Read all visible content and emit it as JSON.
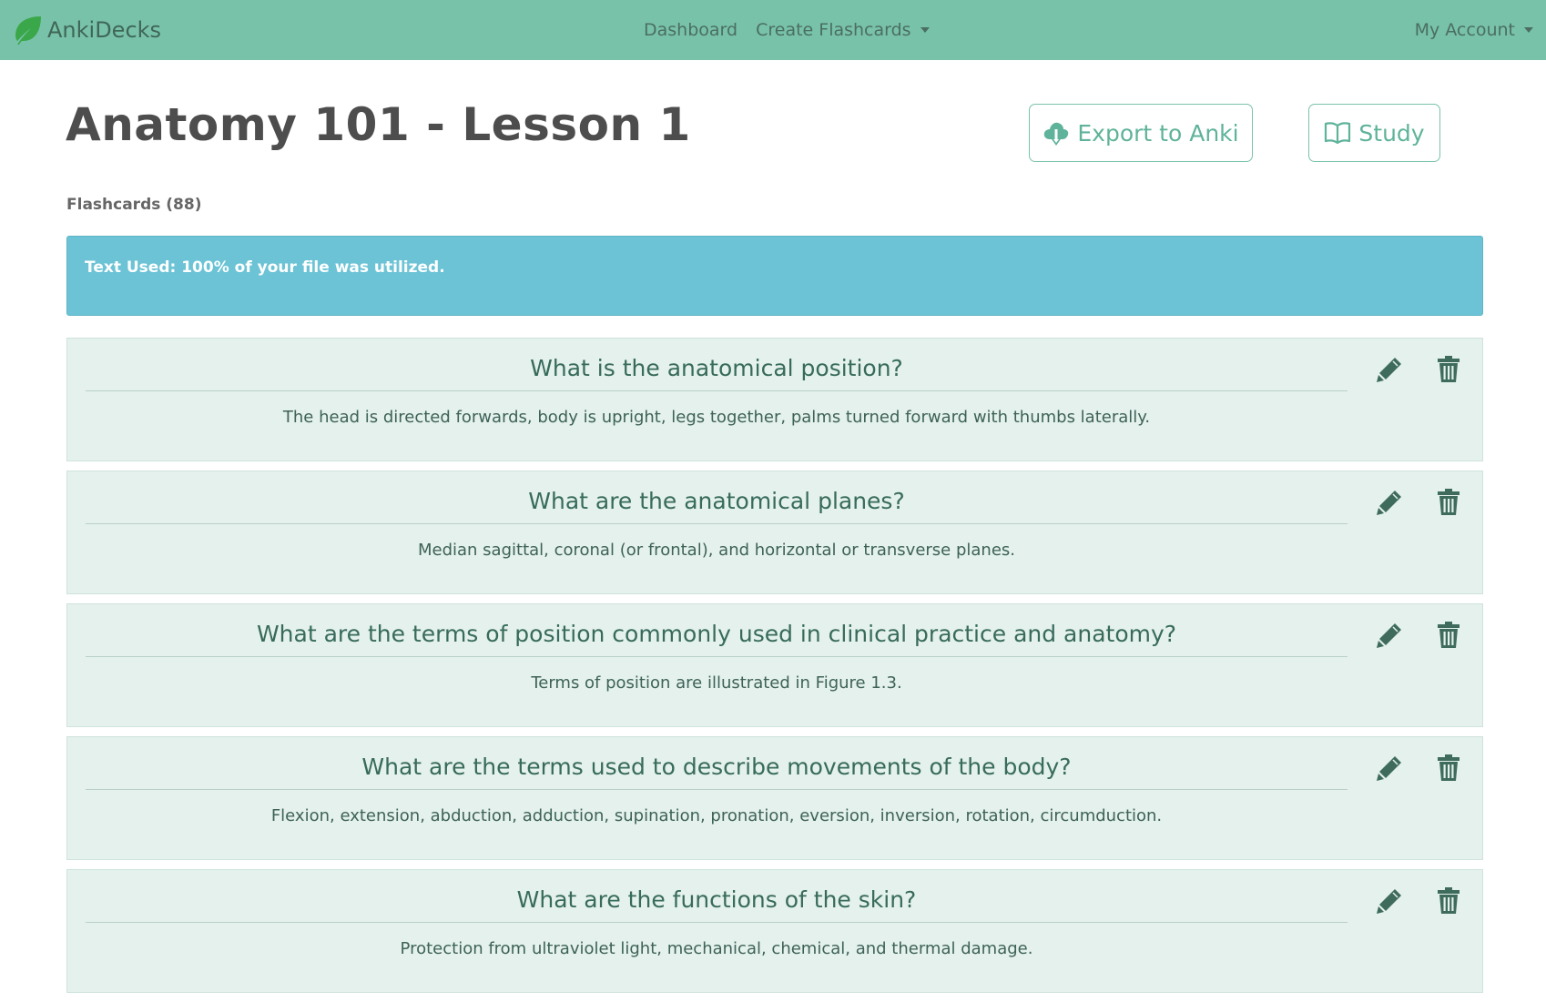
{
  "navbar": {
    "brand": "AnkiDecks",
    "links": [
      "Dashboard",
      "Create Flashcards"
    ],
    "account": "My Account",
    "color": "#79c2aa"
  },
  "page": {
    "title": "Anatomy 101 - Lesson 1",
    "export_label": "Export to Anki",
    "study_label": "Study",
    "count_label": "Flashcards (88)"
  },
  "alert": {
    "text": "Text Used: 100% of your file was utilized.",
    "color": "#6bc3d5"
  },
  "cards": [
    {
      "question": "What is the anatomical position?",
      "answer": "The head is directed forwards, body is upright, legs together, palms turned forward with thumbs laterally."
    },
    {
      "question": "What are the anatomical planes?",
      "answer": "Median sagittal, coronal (or frontal), and horizontal or transverse planes."
    },
    {
      "question": "What are the terms of position commonly used in clinical practice and anatomy?",
      "answer": "Terms of position are illustrated in Figure 1.3."
    },
    {
      "question": "What are the terms used to describe movements of the body?",
      "answer": "Flexion, extension, abduction, adduction, supination, pronation, eversion, inversion, rotation, circumduction."
    },
    {
      "question": "What are the functions of the skin?",
      "answer": "Protection from ultraviolet light, mechanical, chemical, and thermal damage."
    }
  ],
  "icons": {
    "brand": "leaf-icon",
    "export": "cloud-download-icon",
    "study": "book-icon",
    "edit": "pencil-icon",
    "delete": "trash-icon"
  }
}
